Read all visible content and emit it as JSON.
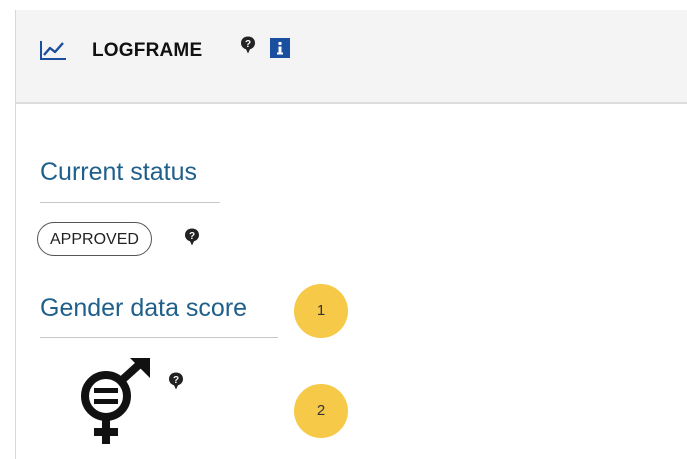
{
  "header": {
    "title": "LOGFRAME",
    "icons": [
      "chart-line-icon",
      "help-icon",
      "info-icon"
    ]
  },
  "current_status": {
    "heading": "Current status",
    "badge": "APPROVED"
  },
  "gender_data_score": {
    "heading": "Gender data score",
    "icon": "gender-equality-icon"
  },
  "callouts": [
    "1",
    "2"
  ],
  "colors": {
    "heading": "#1f5f8b",
    "callout": "#f7c948",
    "info_icon": "#1a4e9e"
  }
}
